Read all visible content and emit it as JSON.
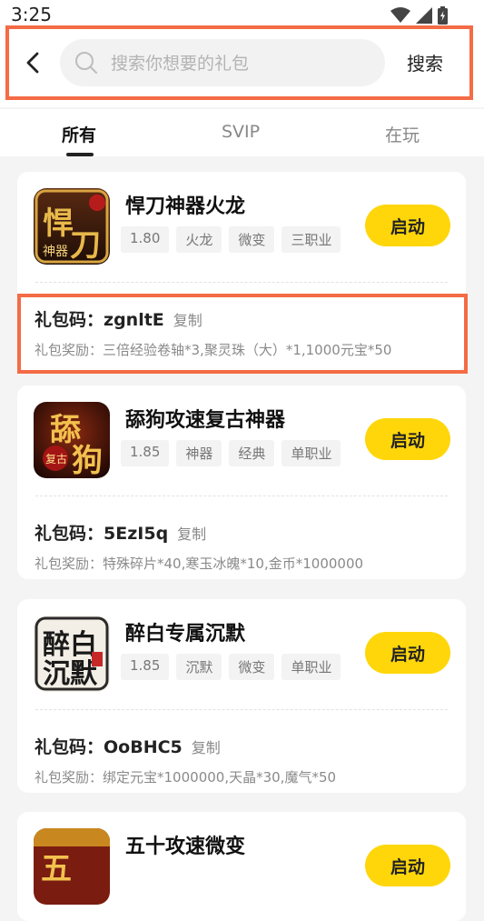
{
  "status_bar": {
    "time": "3:25"
  },
  "search": {
    "placeholder": "搜索你想要的礼包",
    "submit_label": "搜索"
  },
  "tabs": [
    {
      "label": "所有",
      "active": true
    },
    {
      "label": "SVIP",
      "active": false
    },
    {
      "label": "在玩",
      "active": false
    }
  ],
  "cards": [
    {
      "name": "悍刀神器火龙",
      "icon": "game-logo-hdsqhl",
      "tags": [
        "1.80",
        "火龙",
        "微变",
        "三职业"
      ],
      "launch_label": "启动",
      "code_prefix": "礼包码：",
      "code": "zgnltE",
      "copy_label": "复制",
      "reward_prefix": "礼包奖励：",
      "reward": "三倍经验卷轴*3,聚灵珠（大）*1,1000元宝*50"
    },
    {
      "name": "舔狗攻速复古神器",
      "icon": "game-logo-tggsfgsq",
      "tags": [
        "1.85",
        "神器",
        "经典",
        "单职业"
      ],
      "launch_label": "启动",
      "code_prefix": "礼包码：",
      "code": "5EzI5q",
      "copy_label": "复制",
      "reward_prefix": "礼包奖励：",
      "reward": "特殊碎片*40,寒玉冰魄*10,金币*1000000"
    },
    {
      "name": "醉白专属沉默",
      "icon": "game-logo-zbzscm",
      "tags": [
        "1.85",
        "沉默",
        "微变",
        "单职业"
      ],
      "launch_label": "启动",
      "code_prefix": "礼包码：",
      "code": "OoBHC5",
      "copy_label": "复制",
      "reward_prefix": "礼包奖励：",
      "reward": "绑定元宝*1000000,天晶*30,魔气*50"
    },
    {
      "name": "五十攻速微变",
      "icon": "game-logo-wsgswb",
      "launch_label": "启动"
    }
  ],
  "colors": {
    "accent": "#ffd60a",
    "highlight": "#f46b45"
  }
}
